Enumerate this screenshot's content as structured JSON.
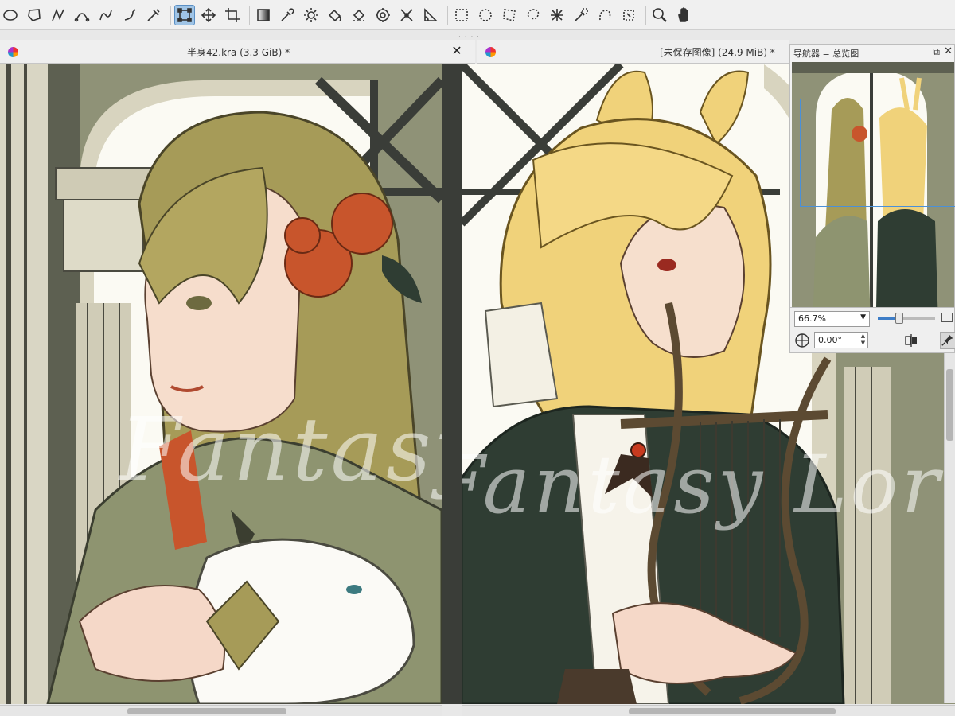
{
  "toolbar": {
    "tools": [
      {
        "icon": "ellipse-tool-icon"
      },
      {
        "icon": "polygon-tool-icon"
      },
      {
        "icon": "polyline-tool-icon"
      },
      {
        "icon": "bezier-curve-tool-icon"
      },
      {
        "icon": "freehand-path-tool-icon"
      },
      {
        "icon": "dynamic-brush-tool-icon"
      },
      {
        "icon": "multibrush-tool-icon"
      },
      {
        "icon": "transform-tool-icon",
        "active": true
      },
      {
        "icon": "move-tool-icon"
      },
      {
        "icon": "crop-tool-icon"
      },
      {
        "icon": "gradient-tool-icon"
      },
      {
        "icon": "color-picker-tool-icon"
      },
      {
        "icon": "smart-patch-tool-icon"
      },
      {
        "icon": "fill-tool-icon"
      },
      {
        "icon": "enclosed-fill-tool-icon"
      },
      {
        "icon": "assistant-tool-icon"
      },
      {
        "icon": "measure-tool-icon"
      },
      {
        "icon": "reference-pin-icon"
      },
      {
        "icon": "rectangular-selection-icon"
      },
      {
        "icon": "elliptical-selection-icon"
      },
      {
        "icon": "polygonal-selection-icon"
      },
      {
        "icon": "freehand-selection-icon"
      },
      {
        "icon": "contiguous-selection-icon"
      },
      {
        "icon": "similar-color-selection-icon"
      },
      {
        "icon": "bezier-selection-icon"
      },
      {
        "icon": "magnetic-selection-icon"
      },
      {
        "icon": "zoom-tool-icon"
      },
      {
        "icon": "pan-tool-icon"
      }
    ]
  },
  "tabs": {
    "left": {
      "title": "半身42.kra  (3.3 GiB)  *",
      "close": "✕"
    },
    "right": {
      "title": "[未保存图像]  (24.9 MiB)  *"
    }
  },
  "navigator": {
    "title": "导航器 = 总览图",
    "float_icon": "⧉",
    "close_icon": "✕",
    "zoom": "66.7%",
    "zoom_fraction": 0.38,
    "rotation": "0.00°"
  },
  "canvas": {
    "watermark": "Fantasy Lore",
    "colors": {
      "wall": "#8f9277",
      "window_light": "#fbfaf3",
      "frame_dark": "#3a3d38",
      "hair_left": "#a69b58",
      "flower": "#c8552c",
      "coat_green": "#8e9470",
      "hair_right": "#f0d27a",
      "dress_dark": "#2f3d33"
    }
  }
}
